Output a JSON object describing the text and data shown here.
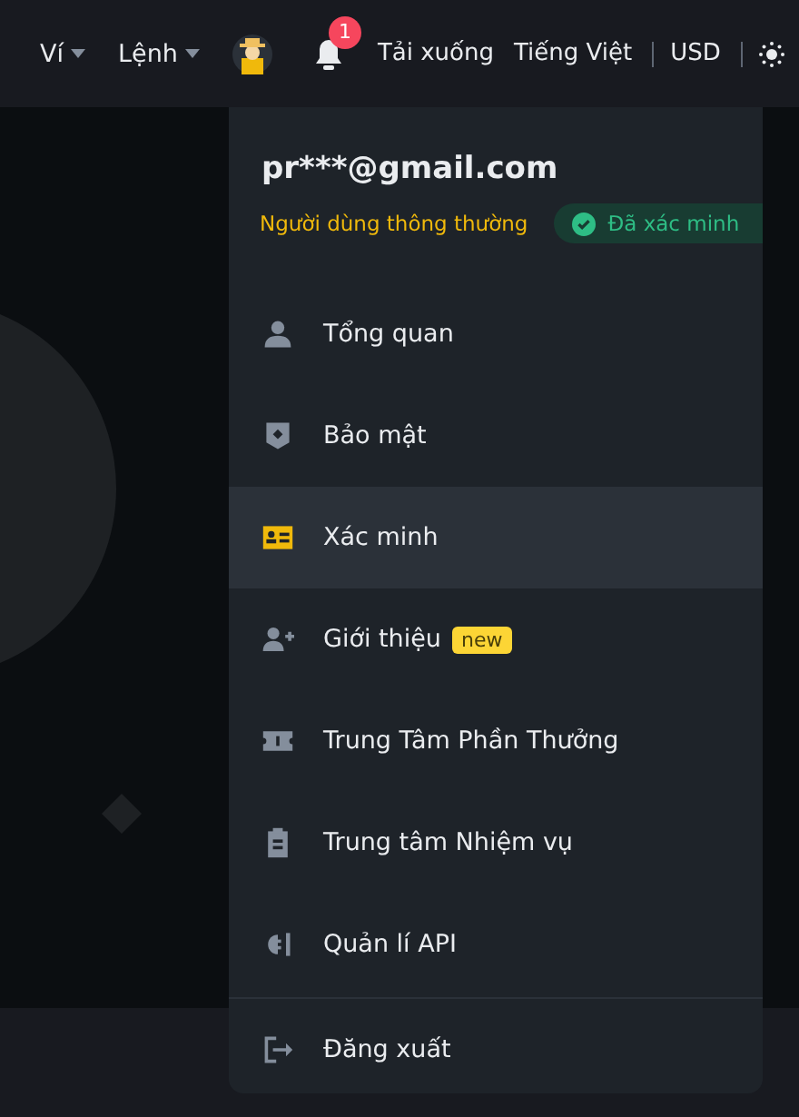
{
  "header": {
    "nav": [
      {
        "label": "Ví",
        "kind": "dropdown"
      },
      {
        "label": "Lệnh",
        "kind": "dropdown"
      }
    ],
    "notification_count": "1",
    "links": [
      {
        "label": "Tải xuống"
      },
      {
        "label": "Tiếng Việt"
      },
      {
        "label": "USD"
      }
    ]
  },
  "account_menu": {
    "email": "pr***@gmail.com",
    "user_level": "Người dùng thông thường",
    "verification": "Đã xác minh",
    "items": [
      {
        "label": "Tổng quan",
        "selected": false
      },
      {
        "label": "Bảo mật",
        "selected": false
      },
      {
        "label": "Xác minh",
        "selected": true
      },
      {
        "label": "Giới thiệu",
        "selected": false,
        "badge": "new"
      },
      {
        "label": "Trung Tâm Phần Thưởng",
        "selected": false
      },
      {
        "label": "Trung tâm Nhiệm vụ",
        "selected": false
      },
      {
        "label": "Quản lí API",
        "selected": false
      }
    ],
    "logout": {
      "label": "Đăng xuất"
    }
  }
}
